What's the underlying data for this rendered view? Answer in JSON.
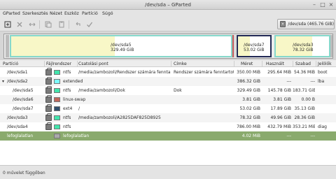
{
  "window": {
    "title": "/dev/sda – GParted",
    "btn_min": "–",
    "btn_max": "□",
    "btn_close": "×"
  },
  "menu": [
    "GParted",
    "Szerkesztés",
    "Nézet",
    "Eszköz",
    "Partíció",
    "Súgó"
  ],
  "toolbar": {
    "new_icon": "new-partition-icon",
    "delete_icon": "delete-icon",
    "resize_icon": "resize-move-icon",
    "copy_icon": "copy-icon",
    "paste_icon": "paste-icon",
    "undo_icon": "undo-icon",
    "apply_icon": "apply-icon",
    "device_label": "/dev/sda  (465.76 GiB)"
  },
  "map": {
    "sda5": {
      "name": "/dev/sda5",
      "size": "329.49 GiB"
    },
    "sda7": {
      "name": "/dev/sda7",
      "size": "53.02 GiB"
    },
    "sda3": {
      "name": "/dev/sda3",
      "size": "78.32 GiB"
    }
  },
  "table": {
    "headers": [
      "Partíció",
      "Fájlrendszer",
      "Csatolási pont",
      "Címke",
      "Méret",
      "Használt",
      "Szabad",
      "Jelölők"
    ],
    "rows": [
      {
        "partition": "/dev/sda1",
        "fs": "ntfs",
        "fs_color": "#42e5ac",
        "mount": "/media/zambozoli/Rendszer számára fenntartott",
        "label": "Rendszer számára fenntartott",
        "size": "350.00 MiB",
        "used": "295.64 MiB",
        "free": "54.36 MiB",
        "flags": "boot"
      },
      {
        "partition": "/dev/sda2",
        "fs": "extended",
        "fs_color": "#7dfcfe",
        "mount": "",
        "label": "",
        "size": "386.32 GiB",
        "used": "---",
        "free": "---",
        "flags": "lba"
      },
      {
        "partition": "/dev/sda5",
        "fs": "ntfs",
        "fs_color": "#42e5ac",
        "mount": "/media/zambozoli/Dok",
        "label": "Dok",
        "size": "329.49 GiB",
        "used": "145.78 GiB",
        "free": "183.71 GiB",
        "flags": ""
      },
      {
        "partition": "/dev/sda6",
        "fs": "linux-swap",
        "fs_color": "#c1665a",
        "mount": "",
        "label": "",
        "size": "3.81 GiB",
        "used": "3.81 GiB",
        "free": "0.00 B",
        "flags": ""
      },
      {
        "partition": "/dev/sda7",
        "fs": "ext4",
        "fs_color": "#314e6c",
        "mount": "/",
        "label": "",
        "size": "53.02 GiB",
        "used": "17.89 GiB",
        "free": "35.13 GiB",
        "flags": ""
      },
      {
        "partition": "/dev/sda3",
        "fs": "ntfs",
        "fs_color": "#42e5ac",
        "mount": "/media/zambozoli/A2825DAF825D8925",
        "label": "",
        "size": "78.32 GiB",
        "used": "49.96 GiB",
        "free": "28.36 GiB",
        "flags": ""
      },
      {
        "partition": "/dev/sda4",
        "fs": "ntfs",
        "fs_color": "#42e5ac",
        "mount": "",
        "label": "",
        "size": "786.00 MiB",
        "used": "432.79 MiB",
        "free": "353.21 MiB",
        "flags": "diag"
      },
      {
        "partition": "lefoglalatlan",
        "fs": "lefoglalatlan",
        "fs_color": "#a9a9a9",
        "mount": "",
        "label": "",
        "size": "4.02 MiB",
        "used": "---",
        "free": "---",
        "flags": ""
      }
    ]
  },
  "status": "0 művelet függőben"
}
